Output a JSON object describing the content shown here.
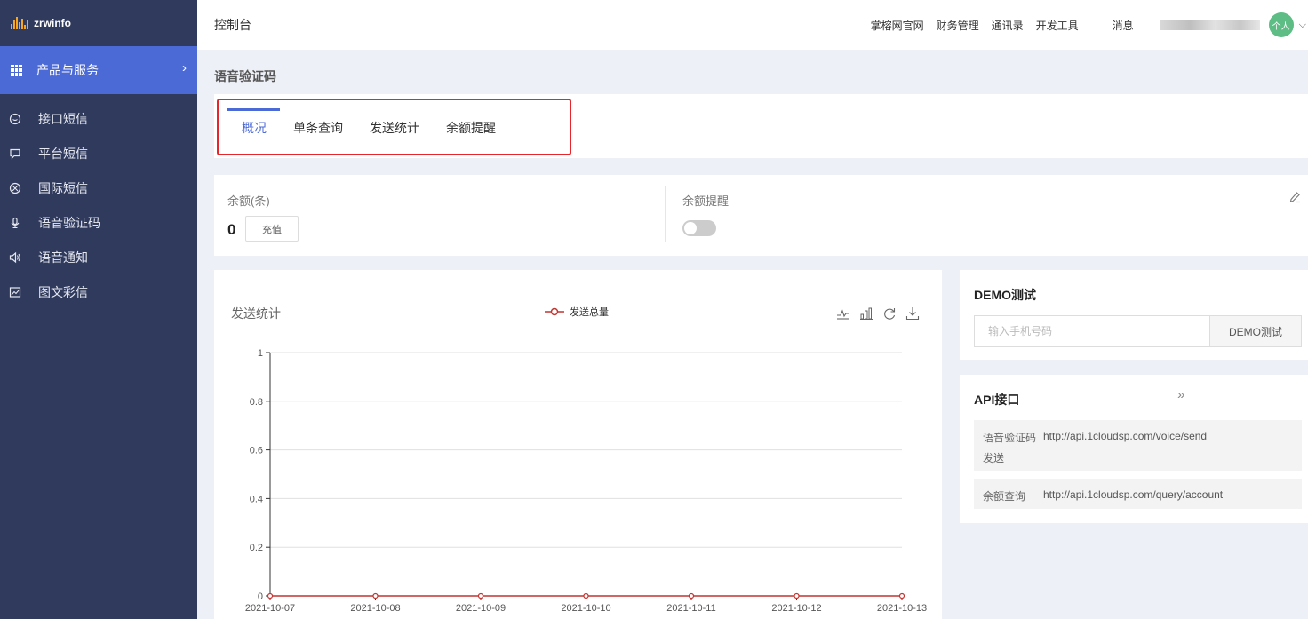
{
  "brand": {
    "name": "zrwinfo"
  },
  "sidebar": {
    "header": {
      "label": "产品与服务",
      "chevron": "chevron-right-icon"
    },
    "items": [
      {
        "label": "接口短信",
        "icon": "chat-bubble-icon"
      },
      {
        "label": "平台短信",
        "icon": "message-square-icon"
      },
      {
        "label": "国际短信",
        "icon": "globe-icon"
      },
      {
        "label": "语音验证码",
        "icon": "microphone-icon"
      },
      {
        "label": "语音通知",
        "icon": "speaker-icon"
      },
      {
        "label": "图文彩信",
        "icon": "image-icon"
      }
    ]
  },
  "header": {
    "title": "控制台",
    "links": [
      "掌榕网官网",
      "财务管理",
      "通讯录",
      "开发工具"
    ],
    "messages": "消息",
    "avatar": "个人"
  },
  "page": {
    "title": "语音验证码"
  },
  "tabs": [
    {
      "label": "概况",
      "active": true
    },
    {
      "label": "单条查询",
      "active": false
    },
    {
      "label": "发送统计",
      "active": false
    },
    {
      "label": "余额提醒",
      "active": false
    }
  ],
  "balance": {
    "label": "余额(条)",
    "value": "0",
    "recharge_label": "充值",
    "reminder_label": "余额提醒",
    "reminder_on": false
  },
  "chart_data": {
    "type": "line",
    "title": "发送统计",
    "categories": [
      "2021-10-07",
      "2021-10-08",
      "2021-10-09",
      "2021-10-10",
      "2021-10-11",
      "2021-10-12",
      "2021-10-13"
    ],
    "series": [
      {
        "name": "发送总量",
        "values": [
          0,
          0,
          0,
          0,
          0,
          0,
          0
        ],
        "color": "#c23531"
      }
    ],
    "ylim": [
      0,
      1
    ],
    "yticks": [
      "0",
      "0.2",
      "0.4",
      "0.6",
      "0.8",
      "1"
    ],
    "legend": "top-center",
    "grid": true
  },
  "demo": {
    "title": "DEMO测试",
    "input_placeholder": "输入手机号码",
    "button_label": "DEMO测试"
  },
  "api": {
    "title": "API接口",
    "more": "»",
    "rows": [
      {
        "label": "语音验证码发送",
        "label_line1": "语音验证码",
        "label_line2": "发送",
        "url": "http://api.1cloudsp.com/voice/send"
      },
      {
        "label": "余额查询",
        "url": "http://api.1cloudsp.com/query/account"
      }
    ]
  },
  "colors": {
    "accent": "#4c6ad6",
    "sidebar": "#303a5c",
    "highlight": "#e6262b",
    "series": "#c23531"
  }
}
